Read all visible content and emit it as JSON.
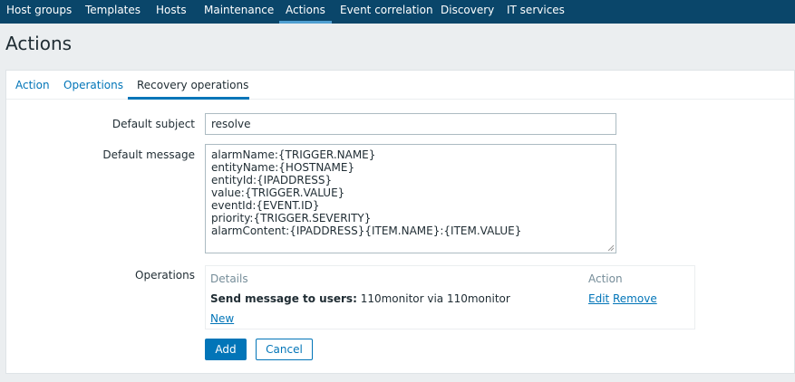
{
  "topnav": {
    "items": [
      {
        "label": "Host groups",
        "active": false
      },
      {
        "label": "Templates",
        "active": false
      },
      {
        "label": "Hosts",
        "active": false
      },
      {
        "label": "Maintenance",
        "active": false
      },
      {
        "label": "Actions",
        "active": true
      },
      {
        "label": "Event correlation",
        "active": false
      },
      {
        "label": "Discovery",
        "active": false
      },
      {
        "label": "IT services",
        "active": false
      }
    ]
  },
  "page": {
    "title": "Actions"
  },
  "tabs": [
    {
      "label": "Action",
      "active": false
    },
    {
      "label": "Operations",
      "active": false
    },
    {
      "label": "Recovery operations",
      "active": true
    }
  ],
  "form": {
    "default_subject": {
      "label": "Default subject",
      "value": "resolve"
    },
    "default_message": {
      "label": "Default message",
      "lines": [
        "alarmName:{TRIGGER.NAME}",
        "entityName:{HOSTNAME}",
        "entityId:{IPADDRESS}",
        "value:{TRIGGER.VALUE}",
        "eventId:{EVENT.ID}",
        "priority:{TRIGGER.SEVERITY}",
        "alarmContent:{IPADDRESS}{ITEM.NAME}:{ITEM.VALUE}"
      ]
    },
    "operations": {
      "label": "Operations",
      "header_details": "Details",
      "header_action": "Action",
      "rows": [
        {
          "details_bold": "Send message to users:",
          "details_rest": " 110monitor via 110monitor",
          "edit": "Edit",
          "remove": "Remove"
        }
      ],
      "new_link": "New"
    },
    "buttons": {
      "add": "Add",
      "cancel": "Cancel"
    }
  },
  "colors": {
    "nav_bg": "#0a466a",
    "accent": "#0275b8",
    "page_bg": "#ebeef0"
  }
}
